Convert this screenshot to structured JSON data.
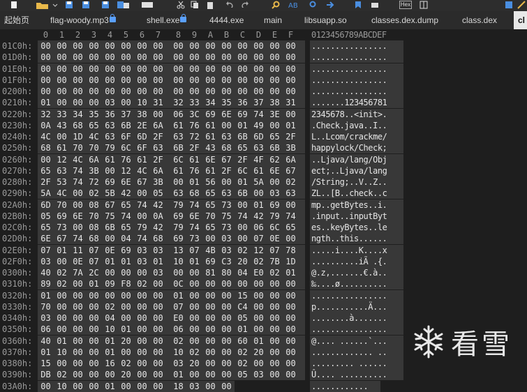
{
  "tabs": [
    {
      "label": "起始页",
      "locked": false,
      "active": false
    },
    {
      "label": "flag-woody.mp3",
      "locked": true,
      "active": false
    },
    {
      "label": "shell.exe",
      "locked": true,
      "active": false
    },
    {
      "label": "4444.exe",
      "locked": false,
      "active": false
    },
    {
      "label": "main",
      "locked": false,
      "active": false
    },
    {
      "label": "libsuapp.so",
      "locked": false,
      "active": false
    },
    {
      "label": "classes.dex.dump",
      "locked": false,
      "active": false
    },
    {
      "label": "class.dex",
      "locked": false,
      "active": false
    },
    {
      "label": "cl",
      "locked": false,
      "active": true
    }
  ],
  "toolbar": {
    "icons": [
      "new-file-icon",
      "open-file-icon",
      "save-icon",
      "save-all-icon",
      "close-file-icon",
      "cut-icon",
      "copy-icon",
      "paste-icon",
      "undo-icon",
      "redo-icon",
      "find-icon",
      "replace-icon",
      "find-next-icon",
      "goto-icon",
      "bookmark-icon",
      "hex-mode-icon",
      "settings-icon"
    ],
    "hex_label": "Hex"
  },
  "header": {
    "columns": [
      "0",
      "1",
      "2",
      "3",
      "4",
      "5",
      "6",
      "7",
      "8",
      "9",
      "A",
      "B",
      "C",
      "D",
      "E",
      "F"
    ],
    "ascii_header": "0123456789ABCDEF"
  },
  "rows": [
    {
      "offset": "01C0h:",
      "bytes": [
        "00",
        "00",
        "00",
        "00",
        "00",
        "00",
        "00",
        "00",
        "00",
        "00",
        "00",
        "00",
        "00",
        "00",
        "00",
        "00"
      ],
      "ascii": "................"
    },
    {
      "offset": "01D0h:",
      "bytes": [
        "00",
        "00",
        "00",
        "00",
        "00",
        "00",
        "00",
        "00",
        "00",
        "00",
        "00",
        "00",
        "00",
        "00",
        "00",
        "00"
      ],
      "ascii": "................"
    },
    {
      "offset": "01E0h:",
      "bytes": [
        "00",
        "00",
        "00",
        "00",
        "00",
        "00",
        "00",
        "00",
        "00",
        "00",
        "00",
        "00",
        "00",
        "00",
        "00",
        "00"
      ],
      "ascii": "................"
    },
    {
      "offset": "01F0h:",
      "bytes": [
        "00",
        "00",
        "00",
        "00",
        "00",
        "00",
        "00",
        "00",
        "00",
        "00",
        "00",
        "00",
        "00",
        "00",
        "00",
        "00"
      ],
      "ascii": "................"
    },
    {
      "offset": "0200h:",
      "bytes": [
        "00",
        "00",
        "00",
        "00",
        "00",
        "00",
        "00",
        "00",
        "00",
        "00",
        "00",
        "00",
        "00",
        "00",
        "00",
        "00"
      ],
      "ascii": "................"
    },
    {
      "offset": "0210h:",
      "bytes": [
        "01",
        "00",
        "00",
        "00",
        "03",
        "00",
        "10",
        "31",
        "32",
        "33",
        "34",
        "35",
        "36",
        "37",
        "38",
        "31"
      ],
      "ascii": ".......123456781"
    },
    {
      "offset": "0220h:",
      "bytes": [
        "32",
        "33",
        "34",
        "35",
        "36",
        "37",
        "38",
        "00",
        "06",
        "3C",
        "69",
        "6E",
        "69",
        "74",
        "3E",
        "00"
      ],
      "ascii": "2345678..<init>."
    },
    {
      "offset": "0230h:",
      "bytes": [
        "0A",
        "43",
        "68",
        "65",
        "63",
        "6B",
        "2E",
        "6A",
        "61",
        "76",
        "61",
        "00",
        "01",
        "49",
        "00",
        "01"
      ],
      "ascii": ".Check.java..I.."
    },
    {
      "offset": "0240h:",
      "bytes": [
        "4C",
        "00",
        "1D",
        "4C",
        "63",
        "6F",
        "6D",
        "2F",
        "63",
        "72",
        "61",
        "63",
        "6B",
        "6D",
        "65",
        "2F"
      ],
      "ascii": "L..Lcom/crackme/"
    },
    {
      "offset": "0250h:",
      "bytes": [
        "68",
        "61",
        "70",
        "70",
        "79",
        "6C",
        "6F",
        "63",
        "6B",
        "2F",
        "43",
        "68",
        "65",
        "63",
        "6B",
        "3B"
      ],
      "ascii": "happylock/Check;"
    },
    {
      "offset": "0260h:",
      "bytes": [
        "00",
        "12",
        "4C",
        "6A",
        "61",
        "76",
        "61",
        "2F",
        "6C",
        "61",
        "6E",
        "67",
        "2F",
        "4F",
        "62",
        "6A"
      ],
      "ascii": "..Ljava/lang/Obj"
    },
    {
      "offset": "0270h:",
      "bytes": [
        "65",
        "63",
        "74",
        "3B",
        "00",
        "12",
        "4C",
        "6A",
        "61",
        "76",
        "61",
        "2F",
        "6C",
        "61",
        "6E",
        "67"
      ],
      "ascii": "ect;..Ljava/lang"
    },
    {
      "offset": "0280h:",
      "bytes": [
        "2F",
        "53",
        "74",
        "72",
        "69",
        "6E",
        "67",
        "3B",
        "00",
        "01",
        "56",
        "00",
        "01",
        "5A",
        "00",
        "02"
      ],
      "ascii": "/String;..V..Z.."
    },
    {
      "offset": "0290h:",
      "bytes": [
        "5A",
        "4C",
        "00",
        "02",
        "5B",
        "42",
        "00",
        "05",
        "63",
        "68",
        "65",
        "63",
        "6B",
        "00",
        "03",
        "63"
      ],
      "ascii": "ZL..[B..check..c"
    },
    {
      "offset": "02A0h:",
      "bytes": [
        "6D",
        "70",
        "00",
        "08",
        "67",
        "65",
        "74",
        "42",
        "79",
        "74",
        "65",
        "73",
        "00",
        "01",
        "69",
        "00"
      ],
      "ascii": "mp..getBytes..i."
    },
    {
      "offset": "02B0h:",
      "bytes": [
        "05",
        "69",
        "6E",
        "70",
        "75",
        "74",
        "00",
        "0A",
        "69",
        "6E",
        "70",
        "75",
        "74",
        "42",
        "79",
        "74"
      ],
      "ascii": ".input..inputByt"
    },
    {
      "offset": "02C0h:",
      "bytes": [
        "65",
        "73",
        "00",
        "08",
        "6B",
        "65",
        "79",
        "42",
        "79",
        "74",
        "65",
        "73",
        "00",
        "06",
        "6C",
        "65"
      ],
      "ascii": "es..keyBytes..le"
    },
    {
      "offset": "02D0h:",
      "bytes": [
        "6E",
        "67",
        "74",
        "68",
        "00",
        "04",
        "74",
        "68",
        "69",
        "73",
        "00",
        "03",
        "00",
        "07",
        "0E",
        "00"
      ],
      "ascii": "ngth..this......"
    },
    {
      "offset": "02E0h:",
      "bytes": [
        "07",
        "01",
        "11",
        "07",
        "0E",
        "69",
        "03",
        "03",
        "13",
        "07",
        "4B",
        "03",
        "02",
        "12",
        "07",
        "78"
      ],
      "ascii": ".....i....K....x"
    },
    {
      "offset": "02F0h:",
      "bytes": [
        "03",
        "00",
        "0E",
        "07",
        "01",
        "01",
        "03",
        "01",
        "10",
        "01",
        "69",
        "C3",
        "20",
        "02",
        "7B",
        "1D"
      ],
      "ascii": "..........iÃ .{."
    },
    {
      "offset": "0300h:",
      "bytes": [
        "40",
        "02",
        "7A",
        "2C",
        "00",
        "00",
        "00",
        "03",
        "00",
        "00",
        "81",
        "80",
        "04",
        "E0",
        "02",
        "01"
      ],
      "ascii": "@.z,.......€.à.."
    },
    {
      "offset": "0310h:",
      "bytes": [
        "89",
        "02",
        "00",
        "01",
        "09",
        "F8",
        "02",
        "00",
        "0C",
        "00",
        "00",
        "00",
        "00",
        "00",
        "00",
        "00"
      ],
      "ascii": "‰....ø.........."
    },
    {
      "offset": "0320h:",
      "bytes": [
        "01",
        "00",
        "00",
        "00",
        "00",
        "00",
        "00",
        "00",
        "01",
        "00",
        "00",
        "00",
        "15",
        "00",
        "00",
        "00"
      ],
      "ascii": "................"
    },
    {
      "offset": "0330h:",
      "bytes": [
        "70",
        "00",
        "00",
        "00",
        "02",
        "00",
        "00",
        "00",
        "07",
        "00",
        "00",
        "00",
        "C4",
        "00",
        "00",
        "00"
      ],
      "ascii": "p...........Ä..."
    },
    {
      "offset": "0340h:",
      "bytes": [
        "03",
        "00",
        "00",
        "00",
        "04",
        "00",
        "00",
        "00",
        "E0",
        "00",
        "00",
        "00",
        "05",
        "00",
        "00",
        "00"
      ],
      "ascii": "........à......."
    },
    {
      "offset": "0350h:",
      "bytes": [
        "06",
        "00",
        "00",
        "00",
        "10",
        "01",
        "00",
        "00",
        "06",
        "00",
        "00",
        "00",
        "01",
        "00",
        "00",
        "00"
      ],
      "ascii": "................"
    },
    {
      "offset": "0360h:",
      "bytes": [
        "40",
        "01",
        "00",
        "00",
        "01",
        "20",
        "00",
        "00",
        "02",
        "00",
        "00",
        "00",
        "60",
        "01",
        "00",
        "00"
      ],
      "ascii": "@.... ......`..."
    },
    {
      "offset": "0370h:",
      "bytes": [
        "01",
        "10",
        "00",
        "00",
        "01",
        "00",
        "00",
        "00",
        "10",
        "02",
        "00",
        "00",
        "02",
        "20",
        "00",
        "00"
      ],
      "ascii": "............. .."
    },
    {
      "offset": "0380h:",
      "bytes": [
        "15",
        "00",
        "00",
        "00",
        "16",
        "02",
        "00",
        "00",
        "03",
        "20",
        "00",
        "00",
        "02",
        "00",
        "00",
        "00"
      ],
      "ascii": "......... ......"
    },
    {
      "offset": "0390h:",
      "bytes": [
        "DB",
        "02",
        "00",
        "00",
        "00",
        "20",
        "00",
        "00",
        "01",
        "00",
        "00",
        "00",
        "05",
        "03",
        "00",
        "00"
      ],
      "ascii": "Û.... .........."
    },
    {
      "offset": "03A0h:",
      "bytes": [
        "00",
        "10",
        "00",
        "00",
        "01",
        "00",
        "00",
        "00",
        "18",
        "03",
        "00",
        "00",
        "",
        "",
        "",
        ""
      ],
      "ascii": "............"
    }
  ],
  "watermark": {
    "text": "看雪"
  },
  "colors": {
    "bg": "#1e1e1e",
    "row_bg": "#383838",
    "text": "#e6e6e6",
    "offset": "#9a9a9a",
    "tab_active": "#e8e8e8",
    "lock": "#5aa0ff"
  }
}
